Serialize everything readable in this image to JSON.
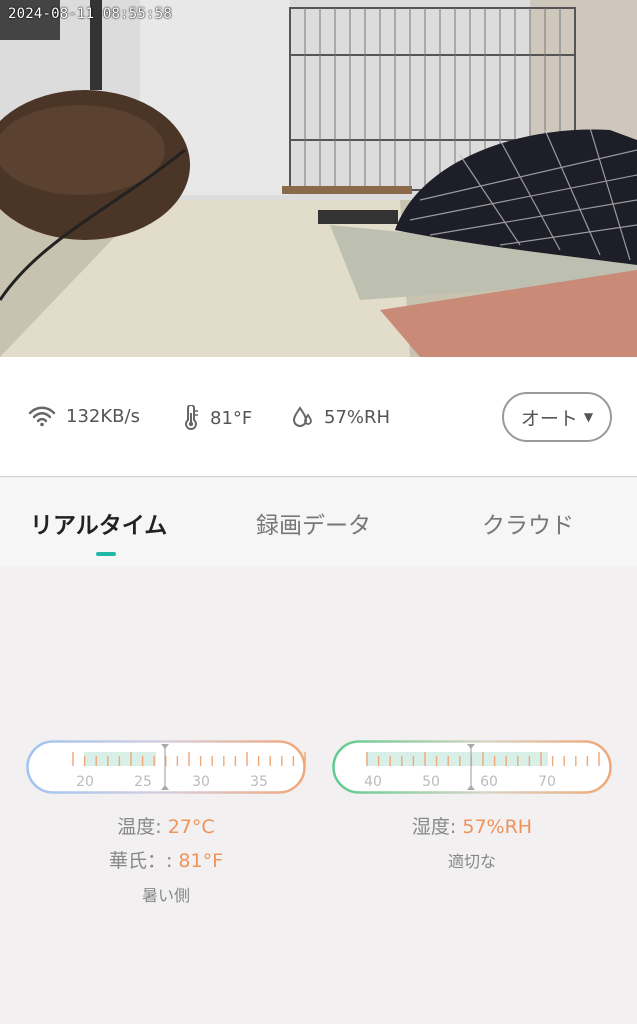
{
  "camera": {
    "timestamp": "2024-08-11 08:55:58"
  },
  "status": {
    "speed": "132KB/s",
    "temperature": "81°F",
    "humidity": "57%RH",
    "mode_label": "オート",
    "icons": [
      "wifi-icon",
      "thermometer-icon",
      "humidity-drop-icon",
      "caret-down-icon"
    ]
  },
  "tabs": [
    {
      "label": "リアルタイム",
      "active": true
    },
    {
      "label": "録画データ",
      "active": false
    },
    {
      "label": "クラウド",
      "active": false
    }
  ],
  "temperature_gauge": {
    "ticks": [
      "20",
      "25",
      "30",
      "35"
    ],
    "current_celsius": 27,
    "label_temp": "温度: ",
    "value_temp": "27°C",
    "label_fahrenheit": "華氏：: ",
    "value_fahrenheit": "81°F",
    "status": "暑い側"
  },
  "humidity_gauge": {
    "ticks": [
      "40",
      "50",
      "60",
      "70"
    ],
    "current_percent": 57,
    "label": "湿度: ",
    "value": "57%RH",
    "status": "適切な"
  },
  "colors": {
    "accent": "#23b8a5",
    "value_orange": "#f0935a",
    "gauge_blue": "#9ec4f0",
    "gauge_green": "#5ecb8e"
  }
}
